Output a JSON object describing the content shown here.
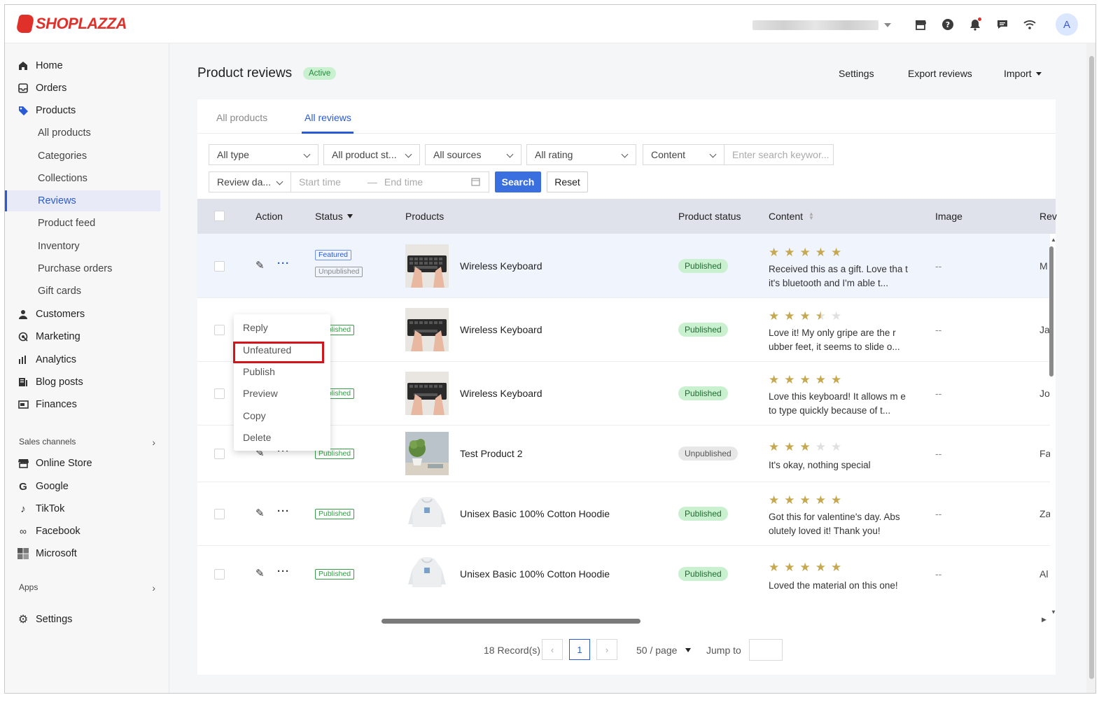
{
  "brand": {
    "name": "SHOPLAZZA",
    "color": "#e0302a"
  },
  "topbar": {
    "avatar_letter": "A",
    "icons": [
      "store-icon",
      "help-icon",
      "bell-icon",
      "chat-icon",
      "wifi-icon"
    ]
  },
  "sidebar": {
    "items": [
      {
        "label": "Home",
        "icon": "home-icon"
      },
      {
        "label": "Orders",
        "icon": "orders-icon"
      },
      {
        "label": "Products",
        "icon": "tag-icon"
      },
      {
        "label": "All products"
      },
      {
        "label": "Categories"
      },
      {
        "label": "Collections"
      },
      {
        "label": "Reviews",
        "active": true
      },
      {
        "label": "Product feed"
      },
      {
        "label": "Inventory"
      },
      {
        "label": "Purchase orders"
      },
      {
        "label": "Gift cards"
      },
      {
        "label": "Customers",
        "icon": "person-icon"
      },
      {
        "label": "Marketing",
        "icon": "marketing-icon"
      },
      {
        "label": "Analytics",
        "icon": "bar-chart-icon"
      },
      {
        "label": "Blog posts",
        "icon": "blog-icon"
      },
      {
        "label": "Finances",
        "icon": "finance-icon"
      }
    ],
    "sales_channels_label": "Sales channels",
    "channels": [
      {
        "label": "Online Store",
        "icon": "store-icon"
      },
      {
        "label": "Google",
        "icon": "google-icon"
      },
      {
        "label": "TikTok",
        "icon": "tiktok-icon"
      },
      {
        "label": "Facebook",
        "icon": "meta-icon"
      },
      {
        "label": "Microsoft",
        "icon": "microsoft-icon"
      }
    ],
    "apps_label": "Apps",
    "settings_label": "Settings"
  },
  "header": {
    "title": "Product reviews",
    "status_badge": "Active",
    "settings_label": "Settings",
    "export_label": "Export reviews",
    "import_label": "Import"
  },
  "tabs": [
    {
      "label": "All products"
    },
    {
      "label": "All reviews",
      "active": true
    }
  ],
  "filters": {
    "type": "All type",
    "product_status": "All product st...",
    "sources": "All sources",
    "rating": "All rating",
    "content": "Content",
    "search_placeholder": "Enter search keywor...",
    "review_date": "Review da...",
    "start_placeholder": "Start time",
    "end_placeholder": "End time",
    "search_button": "Search",
    "reset_button": "Reset"
  },
  "table": {
    "headers": {
      "action": "Action",
      "status": "Status",
      "products": "Products",
      "product_status": "Product status",
      "content": "Content",
      "image": "Image",
      "reviewer": "Rev"
    },
    "rows": [
      {
        "tags": [
          "Featured",
          "Unpublished"
        ],
        "product": "Wireless Keyboard",
        "product_status": "Published",
        "rating": 5,
        "content": "Received this as a gift. Love tha t it's bluetooth and I'm able t...",
        "image": "--",
        "reviewer": "M"
      },
      {
        "tags": [
          "Published"
        ],
        "product": "Wireless Keyboard",
        "product_status": "Published",
        "rating": 3.5,
        "content": "Love it! My only gripe are the r ubber feet, it seems to slide o...",
        "image": "--",
        "reviewer": "Ja"
      },
      {
        "tags": [
          "Published"
        ],
        "product": "Wireless Keyboard",
        "product_status": "Published",
        "rating": 5,
        "content": "Love this keyboard! It allows m e to type quickly because of t...",
        "image": "--",
        "reviewer": "Jo"
      },
      {
        "tags": [
          "Published"
        ],
        "product": "Test Product 2",
        "product_status": "Unpublished",
        "rating": 3,
        "content": "It's okay, nothing special",
        "image": "--",
        "reviewer": "Fa"
      },
      {
        "tags": [
          "Published"
        ],
        "product": "Unisex Basic 100% Cotton Hoodie",
        "product_status": "Published",
        "rating": 5,
        "content": "Got this for valentine's day. Abs olutely loved it! Thank you!",
        "image": "--",
        "reviewer": "Za"
      },
      {
        "tags": [
          "Published"
        ],
        "product": "Unisex Basic 100% Cotton Hoodie",
        "product_status": "Published",
        "rating": 5,
        "content": "Loved the material on this one!",
        "image": "--",
        "reviewer": "Al"
      }
    ]
  },
  "action_menu": {
    "items": [
      "Reply",
      "Unfeatured",
      "Publish",
      "Preview",
      "Copy",
      "Delete"
    ],
    "highlighted": "Unfeatured",
    "highlight_color": "#d4131b"
  },
  "pagination": {
    "records": "18 Record(s)",
    "current_page": "1",
    "per_page": "50 / page",
    "jump_label": "Jump to"
  }
}
